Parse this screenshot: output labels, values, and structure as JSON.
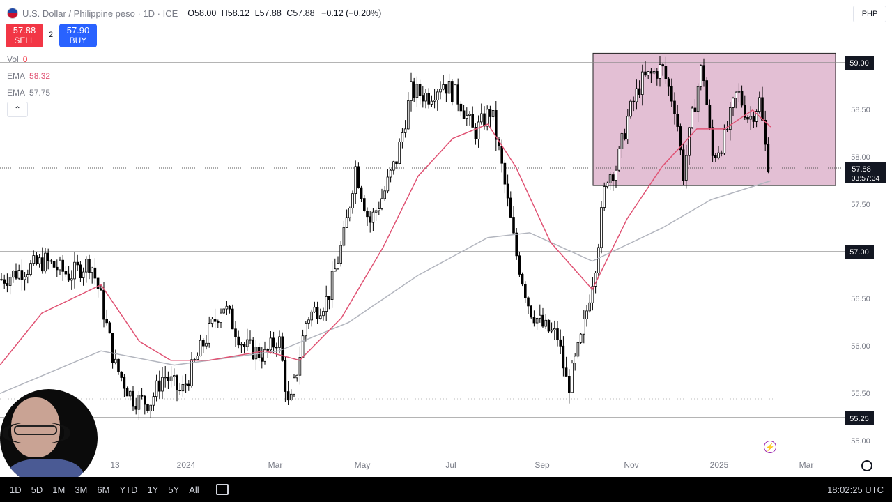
{
  "header": {
    "symbol": "U.S. Dollar / Philippine peso · 1D · ICE",
    "open_key": "O",
    "open": "58.00",
    "high_key": "H",
    "high": "58.12",
    "low_key": "L",
    "low": "57.88",
    "close_key": "C",
    "close": "57.88",
    "change": "−0.12 (−0.20%)"
  },
  "trade": {
    "sell_price": "57.88",
    "sell_label": "SELL",
    "buy_price": "57.90",
    "buy_label": "BUY",
    "spread": "2"
  },
  "indicators": [
    {
      "label": "Vol",
      "value": "0",
      "color": "#f23645"
    },
    {
      "label": "EMA",
      "value": "58.32",
      "color": "#e05273"
    },
    {
      "label": "EMA",
      "value": "57.75",
      "color": "#787b86"
    }
  ],
  "currency": "PHP",
  "bottom": {
    "ranges": [
      "1D",
      "5D",
      "1M",
      "3M",
      "6M",
      "YTD",
      "1Y",
      "5Y",
      "All"
    ],
    "clock": "18:02:25 UTC"
  },
  "chart_data": {
    "type": "candlestick",
    "title": "U.S. Dollar / Philippine peso · 1D · ICE",
    "xlabel": "",
    "ylabel": "",
    "x_tick_labels": [
      "13",
      "2024",
      "Mar",
      "May",
      "Jul",
      "Sep",
      "Nov",
      "2025",
      "Mar"
    ],
    "y_tick_labels": [
      "59.00",
      "58.50",
      "58.00",
      "57.50",
      "57.00",
      "56.50",
      "56.00",
      "55.50",
      "55.25",
      "55.00"
    ],
    "ylim": [
      54.9,
      59.6
    ],
    "price_path": [
      [
        0,
        56.7
      ],
      [
        30,
        56.8
      ],
      [
        65,
        56.9
      ],
      [
        100,
        56.75
      ],
      [
        130,
        56.9
      ],
      [
        145,
        56.5
      ],
      [
        165,
        55.8
      ],
      [
        190,
        55.45
      ],
      [
        215,
        55.4
      ],
      [
        235,
        55.7
      ],
      [
        260,
        55.5
      ],
      [
        290,
        56.0
      ],
      [
        320,
        56.45
      ],
      [
        350,
        56.0
      ],
      [
        380,
        55.9
      ],
      [
        400,
        56.1
      ],
      [
        415,
        55.3
      ],
      [
        440,
        56.3
      ],
      [
        470,
        56.5
      ],
      [
        495,
        57.2
      ],
      [
        510,
        57.9
      ],
      [
        530,
        57.3
      ],
      [
        550,
        57.6
      ],
      [
        570,
        58.0
      ],
      [
        590,
        58.7
      ],
      [
        615,
        58.65
      ],
      [
        635,
        58.8
      ],
      [
        660,
        58.6
      ],
      [
        680,
        58.25
      ],
      [
        705,
        58.5
      ],
      [
        720,
        57.9
      ],
      [
        740,
        57.0
      ],
      [
        760,
        56.4
      ],
      [
        780,
        56.2
      ],
      [
        800,
        56.1
      ],
      [
        815,
        55.55
      ],
      [
        835,
        56.1
      ],
      [
        855,
        56.9
      ],
      [
        870,
        57.8
      ],
      [
        885,
        57.9
      ],
      [
        900,
        58.4
      ],
      [
        920,
        58.8
      ],
      [
        950,
        58.95
      ],
      [
        970,
        58.5
      ],
      [
        980,
        57.8
      ],
      [
        995,
        58.5
      ],
      [
        1008,
        59.0
      ],
      [
        1022,
        58.0
      ],
      [
        1040,
        58.2
      ],
      [
        1058,
        58.7
      ],
      [
        1075,
        58.4
      ],
      [
        1090,
        58.6
      ],
      [
        1100,
        58.0
      ],
      [
        1106,
        57.88
      ]
    ],
    "ema_50_path": [
      [
        0,
        55.8
      ],
      [
        60,
        56.35
      ],
      [
        145,
        56.65
      ],
      [
        200,
        56.05
      ],
      [
        245,
        55.85
      ],
      [
        300,
        55.85
      ],
      [
        380,
        55.95
      ],
      [
        430,
        55.85
      ],
      [
        490,
        56.3
      ],
      [
        550,
        57.05
      ],
      [
        600,
        57.8
      ],
      [
        650,
        58.2
      ],
      [
        700,
        58.35
      ],
      [
        740,
        57.9
      ],
      [
        790,
        57.1
      ],
      [
        850,
        56.6
      ],
      [
        900,
        57.35
      ],
      [
        950,
        57.9
      ],
      [
        1000,
        58.3
      ],
      [
        1040,
        58.3
      ],
      [
        1080,
        58.5
      ],
      [
        1106,
        58.32
      ]
    ],
    "ema_200_path": [
      [
        0,
        55.5
      ],
      [
        145,
        55.95
      ],
      [
        250,
        55.8
      ],
      [
        400,
        55.95
      ],
      [
        500,
        56.25
      ],
      [
        600,
        56.75
      ],
      [
        700,
        57.15
      ],
      [
        760,
        57.2
      ],
      [
        850,
        56.9
      ],
      [
        950,
        57.25
      ],
      [
        1020,
        57.55
      ],
      [
        1106,
        57.75
      ]
    ],
    "horizontal_levels": [
      59.0,
      57.0,
      55.25
    ],
    "range_box": {
      "from_price": 57.7,
      "to_price": 59.1,
      "color": "#d9a9c6"
    },
    "last_price": "57.88",
    "countdown": "03:57:34"
  }
}
